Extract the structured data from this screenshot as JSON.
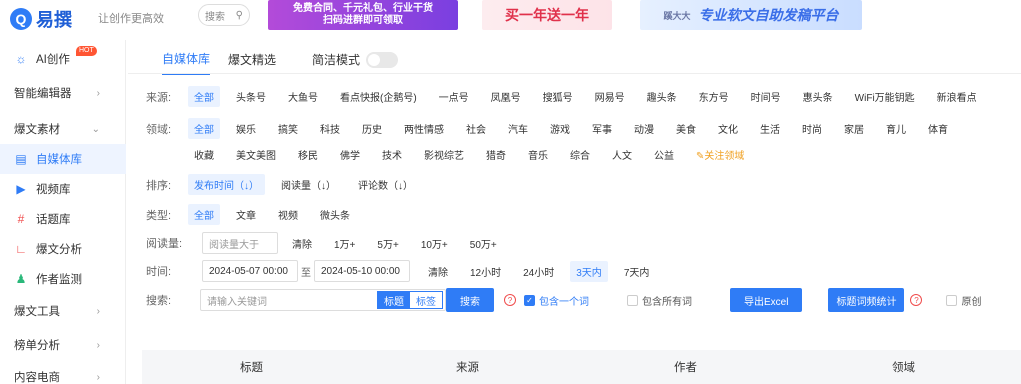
{
  "header": {
    "logo_mark": "Q",
    "logo_text": "易撰",
    "slogan": "让创作更高效",
    "search_label": "搜索",
    "banner1_line1": "免费合同、千元礼包、行业干货",
    "banner1_line2": "扫码进群即可领取",
    "banner2": "买一年送一年",
    "banner3_small": "蹊大大",
    "banner3": "专业软文自助发稿平台"
  },
  "sidebar": {
    "items": [
      {
        "label": "AI创作",
        "icon": "ai-icon",
        "badge": "HOT"
      },
      {
        "label": "智能编辑器"
      },
      {
        "label": "爆文素材"
      },
      {
        "label": "自媒体库",
        "icon": "library-icon"
      },
      {
        "label": "视频库",
        "icon": "video-icon"
      },
      {
        "label": "话题库",
        "icon": "hashtag-icon"
      },
      {
        "label": "爆文分析",
        "icon": "chart-icon"
      },
      {
        "label": "作者监测",
        "icon": "user-add-icon"
      },
      {
        "label": "爆文工具"
      },
      {
        "label": "榜单分析"
      },
      {
        "label": "内容电商"
      }
    ]
  },
  "tabs": {
    "t1": "自媒体库",
    "t2": "爆文精选",
    "simple_mode": "简洁模式"
  },
  "filters": {
    "source_label": "来源:",
    "sources": [
      "全部",
      "头条号",
      "大鱼号",
      "看点快报(企鹅号)",
      "一点号",
      "凤凰号",
      "搜狐号",
      "网易号",
      "趣头条",
      "东方号",
      "时间号",
      "惠头条",
      "WiFi万能钥匙",
      "新浪看点"
    ],
    "field_label": "领域:",
    "fields_row1": [
      "全部",
      "娱乐",
      "搞笑",
      "科技",
      "历史",
      "两性情感",
      "社会",
      "汽车",
      "游戏",
      "军事",
      "动漫",
      "美食",
      "文化",
      "生活",
      "时尚",
      "家居",
      "育儿",
      "体育"
    ],
    "fields_row2": [
      "收藏",
      "美文美图",
      "移民",
      "佛学",
      "技术",
      "影视综艺",
      "猎奇",
      "音乐",
      "综合",
      "人文",
      "公益"
    ],
    "follow_field": "关注领域",
    "sort_label": "排序:",
    "sorts": [
      "发布时间（↓）",
      "阅读量（↓）",
      "评论数（↓）"
    ],
    "type_label": "类型:",
    "types": [
      "全部",
      "文章",
      "视频",
      "微头条"
    ],
    "read_label": "阅读量:",
    "read_placeholder": "阅读量大于",
    "read_options": [
      "清除",
      "1万+",
      "5万+",
      "10万+",
      "50万+"
    ],
    "time_label": "时间:",
    "date_from": "2024-05-07 00:00",
    "date_to_sep": "至",
    "date_to": "2024-05-10 00:00",
    "time_options": [
      "清除",
      "12小时",
      "24小时",
      "3天内",
      "7天内"
    ],
    "search_label": "搜索:",
    "search_placeholder": "请输入关键词",
    "seg_title": "标题",
    "seg_tag": "标签",
    "search_btn": "搜索",
    "include_one": "包含一个词",
    "include_all": "包含所有词",
    "export_btn": "导出Excel",
    "stats_btn": "标题词频统计",
    "original": "原创"
  },
  "table": {
    "headers": [
      "标题",
      "来源",
      "作者",
      "领域"
    ]
  },
  "colors": {
    "accent": "#2f7cf6",
    "follow": "#f0a020"
  }
}
